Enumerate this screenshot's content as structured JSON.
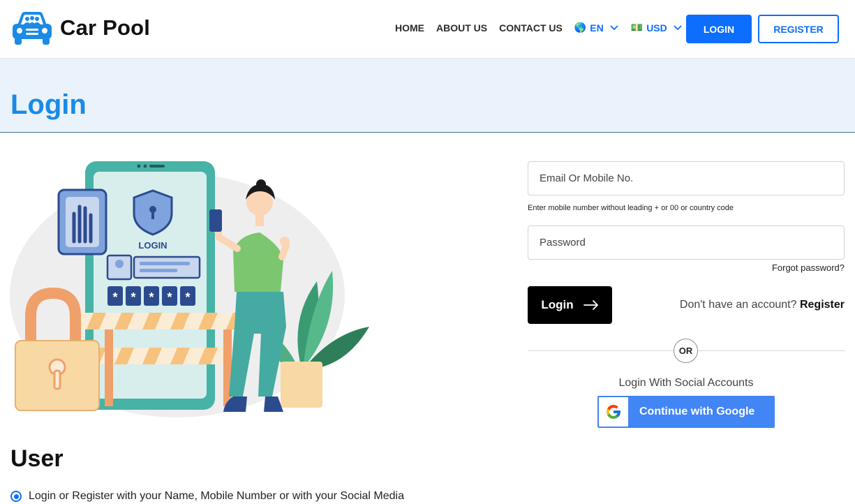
{
  "brand": {
    "name": "Car Pool",
    "logo_icon": "car-icon"
  },
  "nav": {
    "links": [
      "HOME",
      "ABOUT US",
      "CONTACT US"
    ],
    "language": {
      "flag": "🌎",
      "label": "EN"
    },
    "currency": {
      "flag": "💵",
      "label": "USD"
    },
    "login_label": "LOGIN",
    "register_label": "REGISTER"
  },
  "banner": {
    "title": "Login"
  },
  "form": {
    "email_placeholder": "Email Or Mobile No.",
    "email_hint": "Enter mobile number without leading + or 00 or country code",
    "password_placeholder": "Password",
    "forgot_label": "Forgot password?",
    "login_label": "Login",
    "register_prompt": "Don't have an account?",
    "register_link": "Register",
    "or_label": "OR",
    "social_title": "Login With Social Accounts",
    "google_label": "Continue with Google"
  },
  "user_section": {
    "title": "User",
    "items": [
      "Login or Register with your Name, Mobile Number or with your Social Media"
    ]
  },
  "colors": {
    "accent": "#0d6efd",
    "title_blue": "#1a8be6",
    "google_blue": "#4285f4",
    "banner_bg": "#eaf3fc"
  }
}
